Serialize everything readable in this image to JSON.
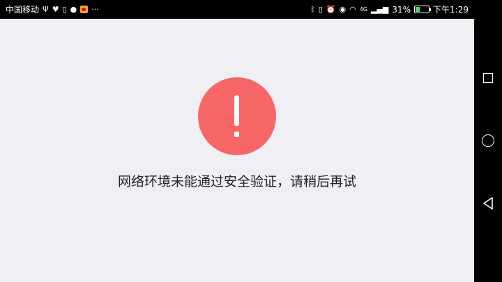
{
  "status_bar": {
    "carrier": "中国移动",
    "icons_left": [
      "usb-icon",
      "heart-rate-icon",
      "phone-icon",
      "wechat-icon",
      "weibo-icon",
      "more-icon"
    ],
    "more": "···",
    "network_label": "4G",
    "battery_percent": "31%",
    "battery_level": 0.31,
    "time": "下午1:29"
  },
  "main": {
    "alert_color": "#f76666",
    "message": "网络环境未能通过安全验证，请稍后再试"
  },
  "nav_bar": {
    "buttons": [
      "recent-apps",
      "home",
      "back"
    ]
  }
}
